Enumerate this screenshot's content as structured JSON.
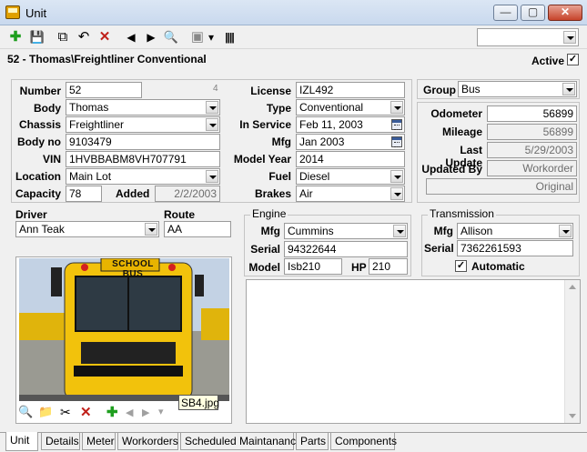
{
  "window": {
    "title": "Unit",
    "min": "—",
    "max": "▢",
    "close": "✕"
  },
  "toolbar": {
    "add": "✚",
    "save": "💾",
    "copy": "⧉",
    "undo": "↶",
    "delete": "✕",
    "prev": "◀",
    "next": "▶",
    "search": "🔍",
    "box": "▣",
    "caret": "▾",
    "barcode": "||||"
  },
  "unit": {
    "header": "52 - Thomas\\Freightliner  Conventional",
    "active_label": "Active",
    "active_check": "✓"
  },
  "left": {
    "number_label": "Number",
    "number": "52",
    "number_aux": "4",
    "body_label": "Body",
    "body": "Thomas",
    "chassis_label": "Chassis",
    "chassis": "Freightliner",
    "bodyno_label": "Body no",
    "bodyno": "9103479",
    "vin_label": "VIN",
    "vin": "1HVBBABM8VH707791",
    "location_label": "Location",
    "location": "Main Lot",
    "capacity_label": "Capacity",
    "capacity": "78",
    "added_label": "Added",
    "added": "2/2/2003"
  },
  "mid": {
    "license_label": "License",
    "license": "IZL492",
    "type_label": "Type",
    "type": "Conventional",
    "inservice_label": "In Service",
    "inservice": "Feb 11, 2003",
    "mfg_label": "Mfg",
    "mfg": "Jan 2003",
    "modelyear_label": "Model Year",
    "modelyear": "2014",
    "fuel_label": "Fuel",
    "fuel": "Diesel",
    "brakes_label": "Brakes",
    "brakes": "Air"
  },
  "right": {
    "group_label": "Group",
    "group": "Bus",
    "odometer_label": "Odometer",
    "odometer": "56899",
    "mileage_label": "Mileage",
    "mileage": "56899",
    "lastupdate_label": "Last Update",
    "lastupdate": "5/29/2003",
    "updatedby_label": "Updated By",
    "updatedby": "Workorder",
    "original": "Original"
  },
  "driver": {
    "driver_label": "Driver",
    "driver": "Ann Teak",
    "route_label": "Route",
    "route": "AA"
  },
  "engine": {
    "title": "Engine",
    "mfg_label": "Mfg",
    "mfg": "Cummins",
    "serial_label": "Serial",
    "serial": "94322644",
    "model_label": "Model",
    "model": "Isb210",
    "hp_label": "HP",
    "hp": "210"
  },
  "transmission": {
    "title": "Transmission",
    "mfg_label": "Mfg",
    "mfg": "Allison",
    "serial_label": "Serial",
    "serial": "7362261593",
    "automatic_label": "Automatic",
    "automatic_check": "✓"
  },
  "photo": {
    "sign": "SCHOOL BUS",
    "filename": "SB4.jpg",
    "zoom": "🔍",
    "folder": "📁",
    "cut": "✂",
    "delete": "✕",
    "add": "✚",
    "prev": "◀",
    "next": "▶",
    "caret": "▾"
  },
  "tabs": [
    "Unit",
    "Details",
    "Meter",
    "Workorders",
    "Scheduled Maintanance",
    "Parts",
    "Components"
  ],
  "colors": {
    "bus_yellow": "#f2c20c",
    "add_green": "#1e9e1e",
    "delete_red": "#c0201a"
  }
}
